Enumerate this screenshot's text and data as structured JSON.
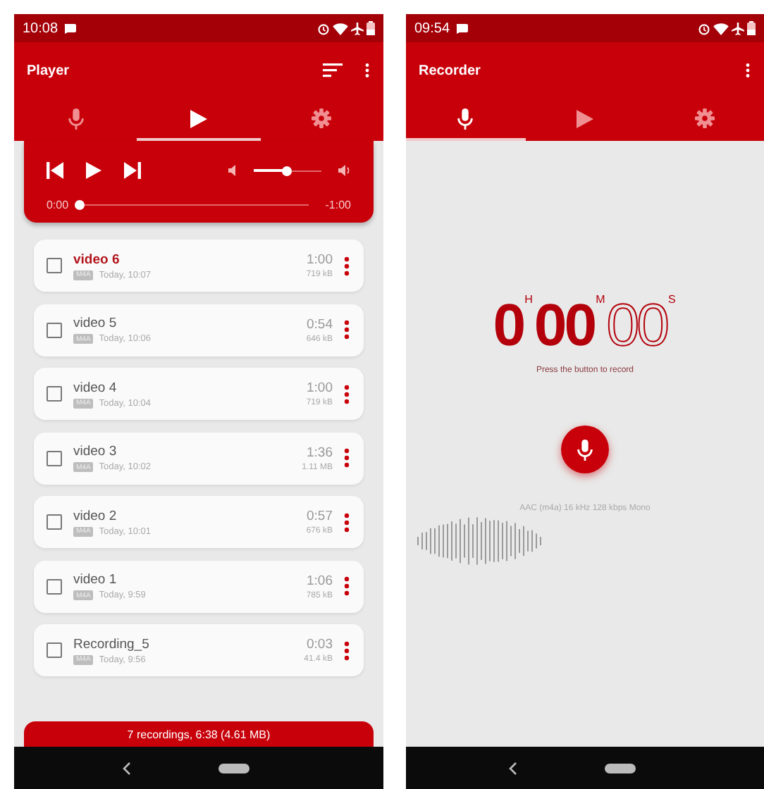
{
  "player": {
    "status_bar": {
      "time": "10:08"
    },
    "app_bar": {
      "title": "Player"
    },
    "tabs": [
      {
        "kind": "mic",
        "selected": false
      },
      {
        "kind": "play",
        "selected": true
      },
      {
        "kind": "settings",
        "selected": false
      }
    ],
    "controls": {
      "volume": {
        "level": 0.48
      },
      "progress": {
        "level": 0.0
      },
      "elapsed": "0:00",
      "remaining": "-1:00"
    },
    "recordings": [
      {
        "name": "video 6",
        "format": "M4A",
        "date": "Today, 10:07",
        "duration": "1:00",
        "size": "719 kB",
        "checked": false,
        "current": true
      },
      {
        "name": "video 5",
        "format": "M4A",
        "date": "Today, 10:06",
        "duration": "0:54",
        "size": "646 kB",
        "checked": false,
        "current": false
      },
      {
        "name": "video 4",
        "format": "M4A",
        "date": "Today, 10:04",
        "duration": "1:00",
        "size": "719 kB",
        "checked": false,
        "current": false
      },
      {
        "name": "video 3",
        "format": "M4A",
        "date": "Today, 10:02",
        "duration": "1:36",
        "size": "1.11 MB",
        "checked": false,
        "current": false
      },
      {
        "name": "video 2",
        "format": "M4A",
        "date": "Today, 10:01",
        "duration": "0:57",
        "size": "676 kB",
        "checked": false,
        "current": false
      },
      {
        "name": "video 1",
        "format": "M4A",
        "date": "Today, 9:59",
        "duration": "1:06",
        "size": "785 kB",
        "checked": false,
        "current": false
      },
      {
        "name": "Recording_5",
        "format": "M4A",
        "date": "Today, 9:56",
        "duration": "0:03",
        "size": "41.4 kB",
        "checked": false,
        "current": false
      }
    ],
    "summary": "7 recordings, 6:38 (4.61 MB)"
  },
  "recorder": {
    "status_bar": {
      "time": "09:54"
    },
    "app_bar": {
      "title": "Recorder"
    },
    "tabs": [
      {
        "kind": "mic",
        "selected": true
      },
      {
        "kind": "play",
        "selected": false
      },
      {
        "kind": "settings",
        "selected": false
      }
    ],
    "timer": {
      "hours": "0",
      "hours_unit": "H",
      "minutes": "00",
      "minutes_unit": "M",
      "seconds": "00",
      "seconds_unit": "S"
    },
    "hint": "Press the button to record",
    "format": "AAC (m4a) 16 kHz 128 kbps Mono"
  }
}
